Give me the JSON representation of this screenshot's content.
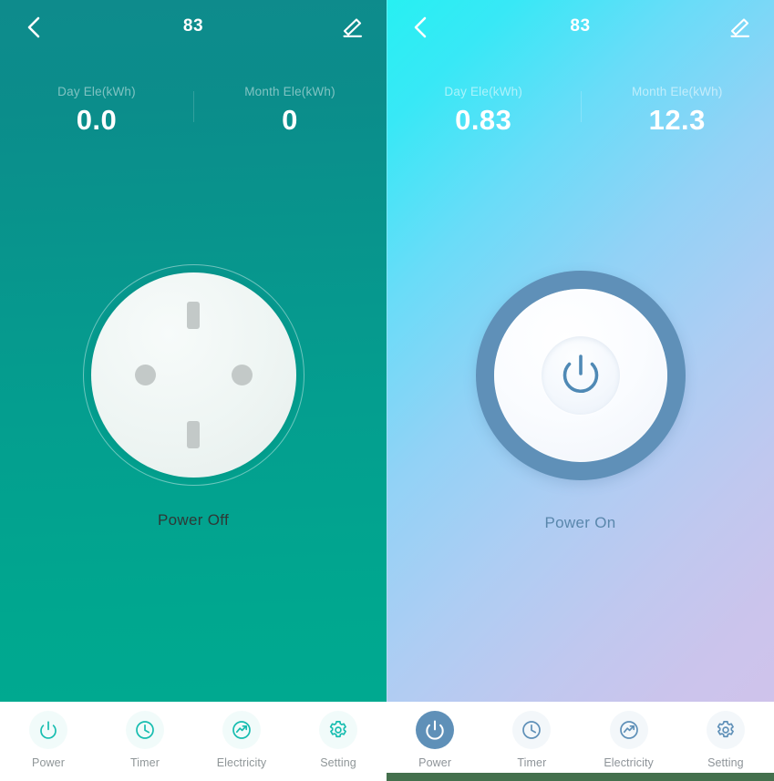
{
  "screens": [
    {
      "id": "power-off",
      "state": "off",
      "header": {
        "back_icon": "chevron-left-icon",
        "title": "83",
        "edit_icon": "pencil-edit-icon"
      },
      "stats": [
        {
          "label": "Day Ele(kWh)",
          "value": "0.0"
        },
        {
          "label": "Month Ele(kWh)",
          "value": "0"
        }
      ],
      "device": {
        "graphic": "power-socket-face-icon",
        "status_label": "Power Off"
      },
      "nav": [
        {
          "label": "Power",
          "icon": "power-icon",
          "active": false
        },
        {
          "label": "Timer",
          "icon": "clock-icon",
          "active": false
        },
        {
          "label": "Electricity",
          "icon": "trend-arrow-circle-icon",
          "active": false
        },
        {
          "label": "Setting",
          "icon": "gear-icon",
          "active": false
        }
      ],
      "colors": {
        "bg_top": "#0e8b8c",
        "bg_bottom": "#01ab91",
        "accent": "#00bfa9",
        "status_text": "#2f3836",
        "nav_label": "#8f9698"
      }
    },
    {
      "id": "power-on",
      "state": "on",
      "header": {
        "back_icon": "chevron-left-icon",
        "title": "83",
        "edit_icon": "pencil-edit-icon"
      },
      "stats": [
        {
          "label": "Day Ele(kWh)",
          "value": "0.83"
        },
        {
          "label": "Month Ele(kWh)",
          "value": "12.3"
        }
      ],
      "device": {
        "graphic": "power-knob-icon",
        "status_label": "Power On"
      },
      "nav": [
        {
          "label": "Power",
          "icon": "power-icon",
          "active": true
        },
        {
          "label": "Timer",
          "icon": "clock-icon",
          "active": false
        },
        {
          "label": "Electricity",
          "icon": "trend-arrow-circle-icon",
          "active": false
        },
        {
          "label": "Setting",
          "icon": "gear-icon",
          "active": false
        }
      ],
      "colors": {
        "bg_start": "#27f0f2",
        "bg_mid": "#92d2f6",
        "bg_end": "#d2c2ea",
        "accent": "#5f90b8",
        "status_text": "#5a87ac",
        "nav_label": "#8e9499",
        "bottom_strip": "#44704d"
      }
    }
  ]
}
